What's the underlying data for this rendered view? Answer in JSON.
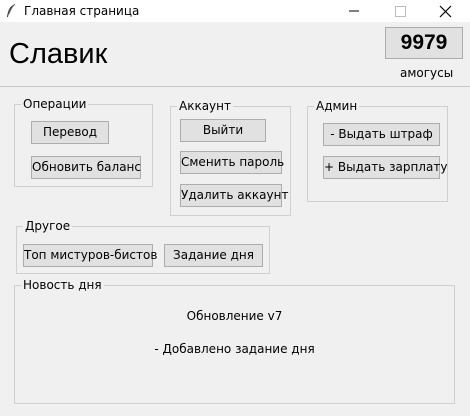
{
  "window": {
    "title": "Главная страница",
    "icon": "feather-icon",
    "controls": {
      "minimize": "minimize-icon",
      "maximize": "maximize-icon",
      "close": "close-icon"
    }
  },
  "header": {
    "app_name": "Славик",
    "balance": "9979",
    "currency": "амогусы"
  },
  "groups": {
    "operations": {
      "label": "Операции",
      "transfer": "Перевод",
      "refresh": "Обновить баланс"
    },
    "account": {
      "label": "Аккаунт",
      "logout": "Выйти",
      "change_password": "Сменить пароль",
      "delete": "Удалить аккаунт"
    },
    "admin": {
      "label": "Админ",
      "fine": "- Выдать штраф",
      "salary": "+ Выдать зарплату"
    },
    "other": {
      "label": "Другое",
      "top": "Топ мистуров-бистов",
      "daily_task": "Задание дня"
    },
    "news": {
      "label": "Новость дня",
      "title": "Обновление v7",
      "body": "- Добавлено задание дня"
    }
  },
  "colors": {
    "background": "#f0f0f0",
    "button": "#e1e1e1",
    "button_border": "#adadad",
    "group_border": "#cfcfcf"
  }
}
